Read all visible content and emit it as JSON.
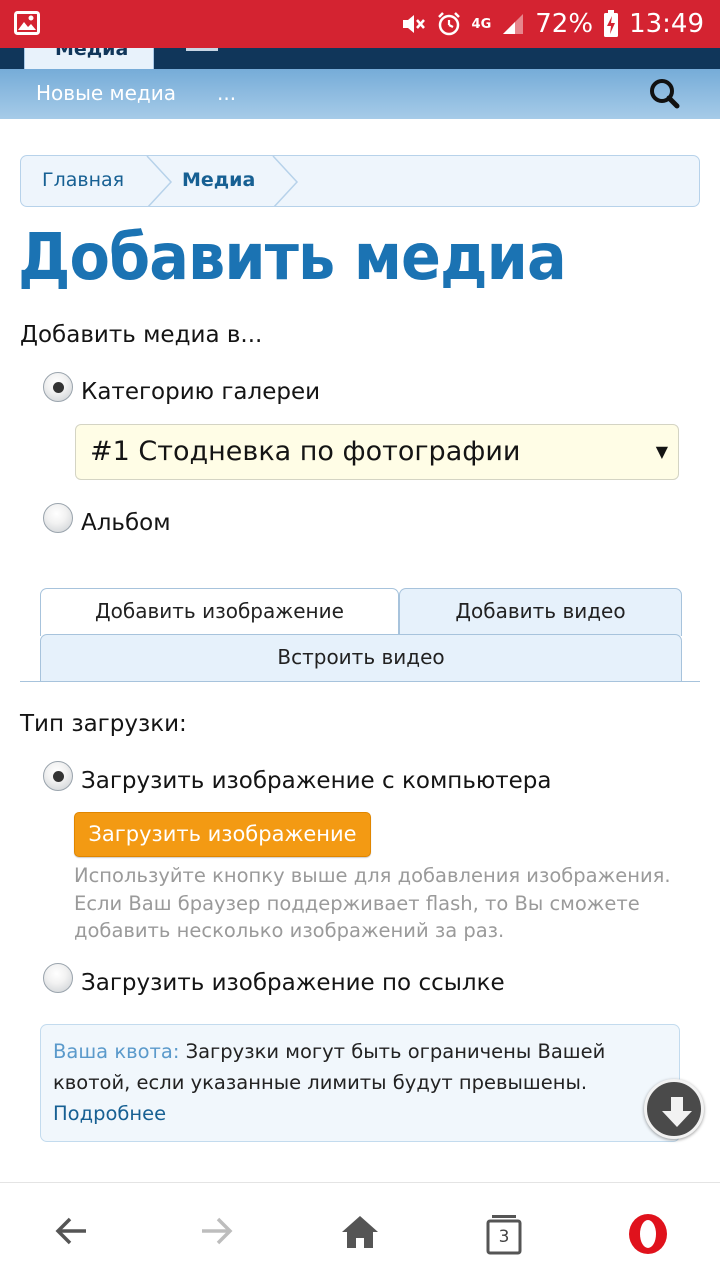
{
  "status_bar": {
    "network": "4G",
    "battery": "72%",
    "time": "13:49"
  },
  "forum_nav": {
    "active_tab": "Медиа",
    "sub_links": [
      "Новые медиа",
      "..."
    ]
  },
  "breadcrumb": {
    "items": [
      "Главная",
      "Медиа"
    ]
  },
  "page": {
    "title": "Добавить медиа",
    "add_to_label": "Добавить медиа в...",
    "option_category": "Категорию галереи",
    "category_select_value": "#1 Стодневка по фотографии",
    "option_album": "Альбом"
  },
  "media_tabs": {
    "add_image": "Добавить изображение",
    "add_video": "Добавить видео",
    "embed_video": "Встроить видео",
    "active": "add_image"
  },
  "upload": {
    "type_label": "Тип загрузки:",
    "option_computer": "Загрузить изображение с компьютера",
    "upload_button": "Загрузить изображение",
    "hint": "Используйте кнопку выше для добавления изображения. Если Ваш браузер поддерживает flash, то Вы сможете добавить несколько изображений за раз.",
    "option_url": "Загрузить изображение по ссылке"
  },
  "quota": {
    "key": "Ваша квота:",
    "text": " Загрузки могут быть ограничены Вашей квотой, если указанные лимиты будут превышены.",
    "more_link": "Подробнее"
  },
  "browser_bar": {
    "tab_count": "3"
  },
  "colors": {
    "status_bar": "#d42331",
    "title_blue": "#1b73b3",
    "button_orange": "#f39a13",
    "opera_red": "#e0121c"
  }
}
